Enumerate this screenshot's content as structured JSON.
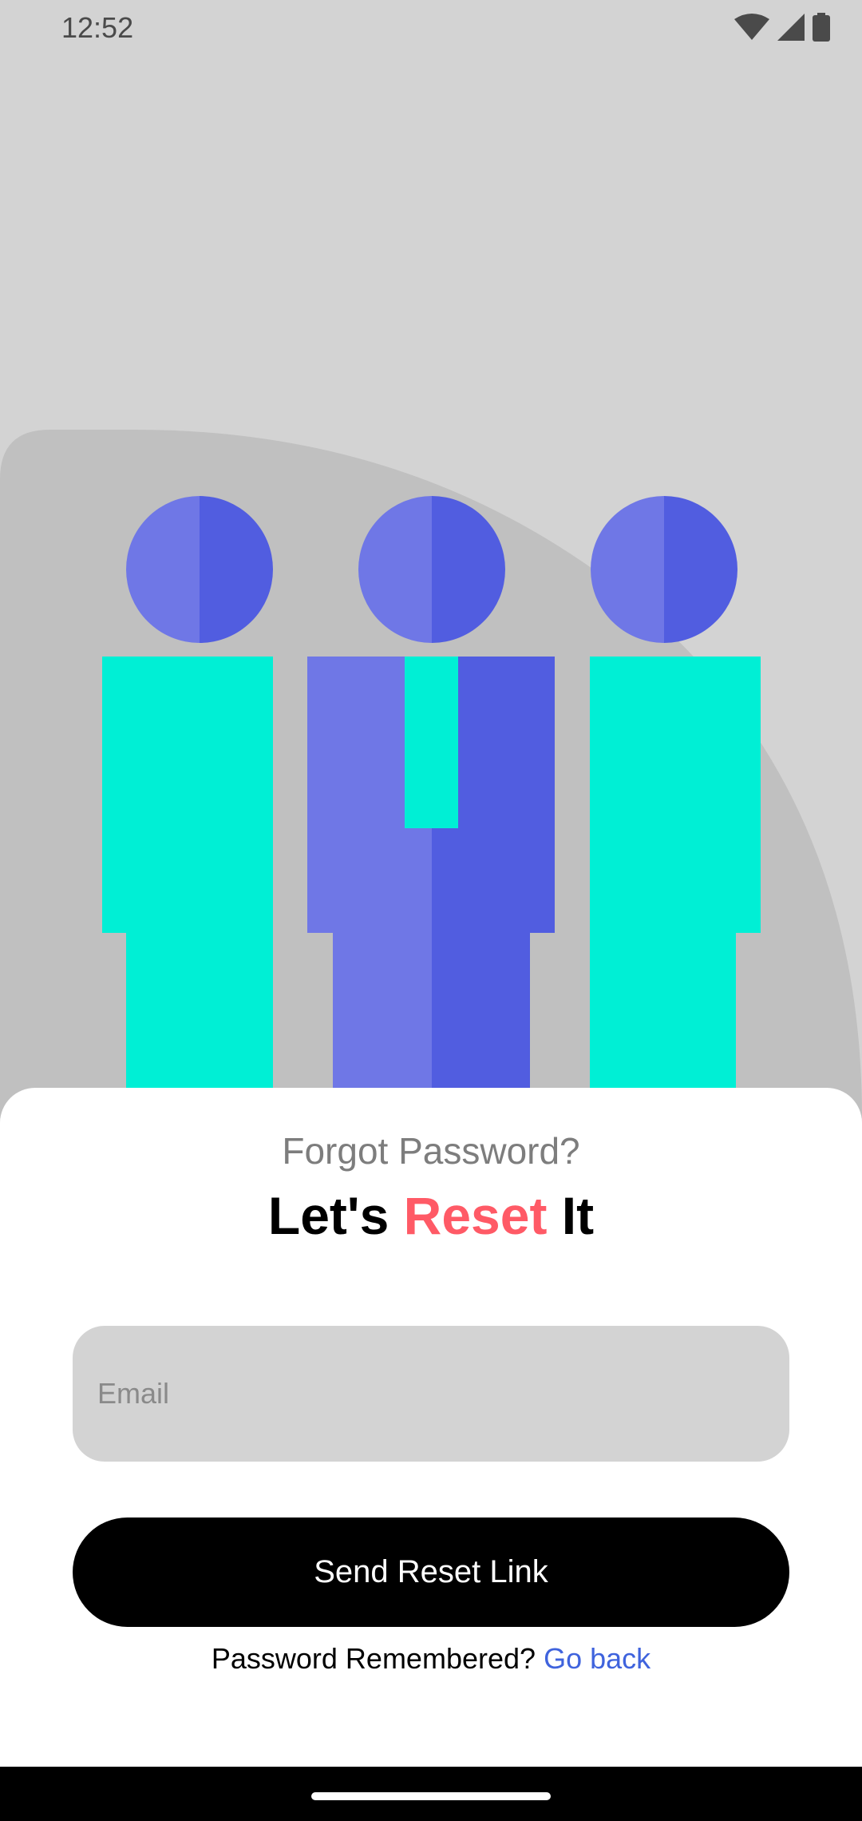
{
  "status_bar": {
    "time": "12:52",
    "icons": [
      "wifi-icon",
      "cellular-signal-icon",
      "battery-icon"
    ]
  },
  "colors": {
    "background": "#d3d3d3",
    "hill": "#c0c0c0",
    "head_light": "#6f77e6",
    "head_dark": "#515de0",
    "teal": "#00efd5",
    "accent": "#ff5a66",
    "link": "#3f63dd",
    "button": "#000000"
  },
  "illustration": {
    "name": "three-people-illustration"
  },
  "form": {
    "subtitle": "Forgot Password?",
    "title_part1": "Let's",
    "title_accent": "Reset",
    "title_part2": "It",
    "email_placeholder": "Email",
    "email_value": "",
    "send_button_label": "Send Reset Link",
    "remembered_text": "Password Remembered?",
    "go_back_label": "Go back"
  }
}
